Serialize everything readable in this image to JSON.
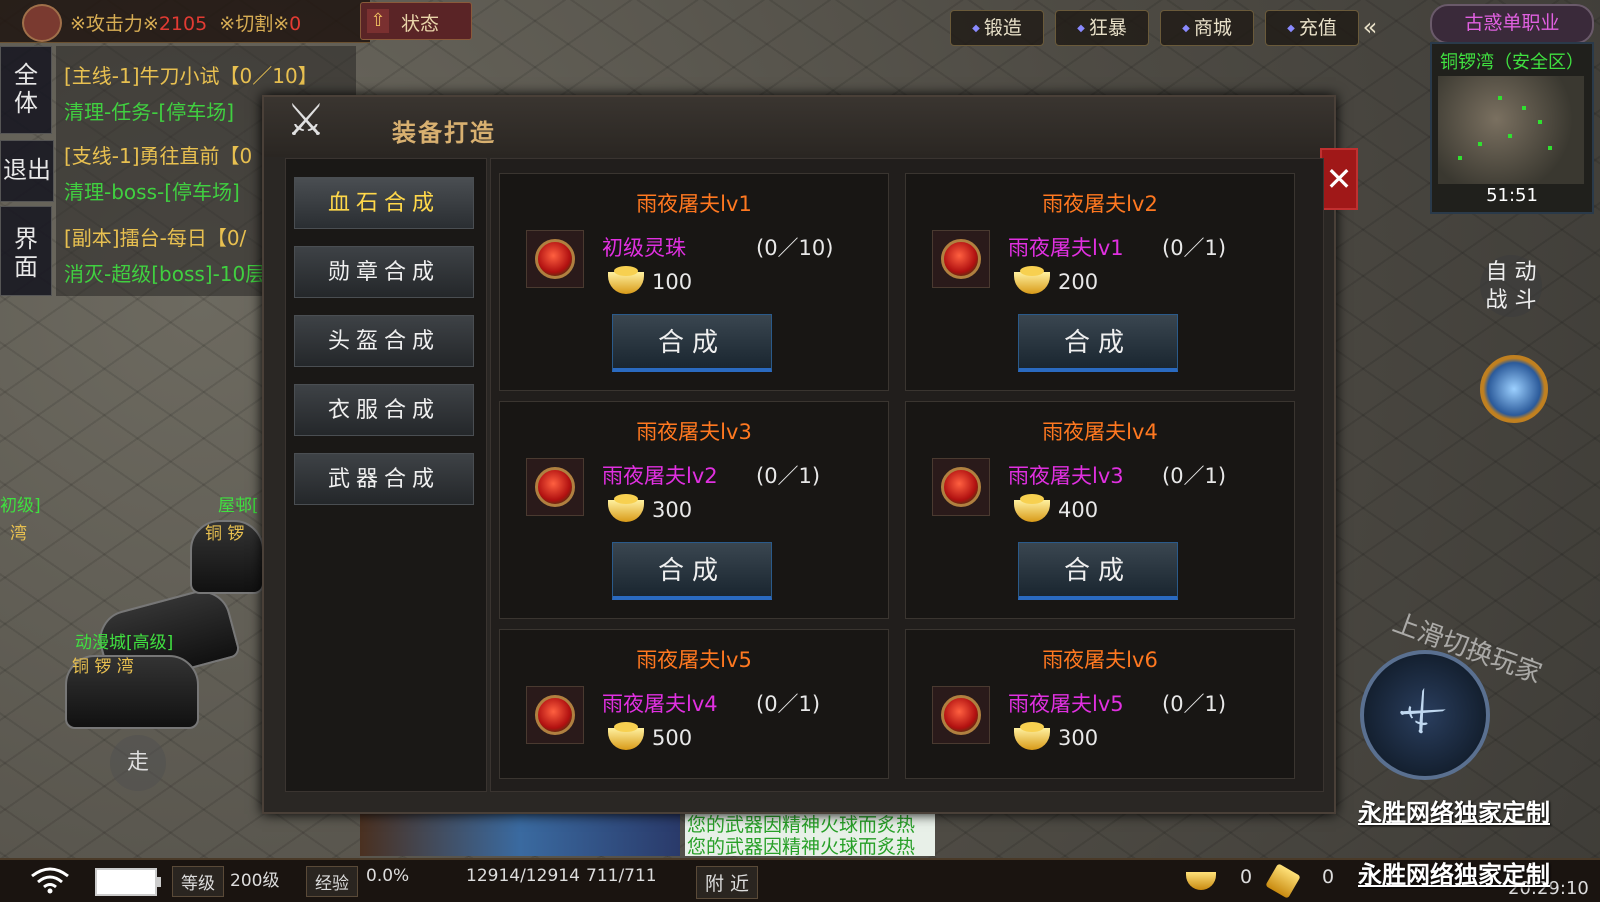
{
  "hud": {
    "attack_label": "※攻击力※",
    "attack_value": "2105",
    "cut_label": "※切割※",
    "cut_value": "0",
    "state_button": "状态",
    "side_buttons": [
      "全\n体",
      "退出",
      "界\n面"
    ],
    "top_tabs": [
      "锻造",
      "狂暴",
      "商城",
      "充值"
    ],
    "collapse": "«",
    "job": "古惑单职业",
    "minimap_zone": "铜锣湾（安全区）",
    "minimap_time": "51:51",
    "auto_fight": "自 动\n战 斗",
    "walk": "走",
    "swipe_hint": "上滑切换玩家",
    "brand_1": "永胜网络独家定制",
    "brand_2": "永胜网络独家定制",
    "clock": "20:29:10"
  },
  "quests": [
    {
      "title": "[主线-1]牛刀小试【0／10】",
      "detail": "清理-任务-[停车场]"
    },
    {
      "title": "[支线-1]勇往直前【0",
      "detail": "清理-boss-[停车场]"
    },
    {
      "title": "[副本]擂台-每日【0/",
      "detail": "消灭-超级[boss]-10层"
    }
  ],
  "npcs": [
    {
      "name": "动漫城[高级]",
      "sub": "铜 锣 湾"
    },
    {
      "name": "屋邨[",
      "sub": "铜 锣"
    },
    {
      "name": "初级]",
      "sub": "湾"
    }
  ],
  "chat": {
    "messages": [
      "您的武器因精神火球而炙热",
      "您的武器因精神火球而炙热"
    ]
  },
  "status_bar": {
    "level_label": "等级",
    "level_value": "200级",
    "exp_label": "经验",
    "exp_value": "0.0%",
    "hp": "12914/12914",
    "mp": "711/711",
    "nearby": "附 近",
    "gold": "0",
    "ticket": "0"
  },
  "dialog": {
    "title": "装备打造",
    "close": "✕",
    "nav": [
      {
        "label": "血石合成",
        "active": true
      },
      {
        "label": "勋章合成",
        "active": false
      },
      {
        "label": "头盔合成",
        "active": false
      },
      {
        "label": "衣服合成",
        "active": false
      },
      {
        "label": "武器合成",
        "active": false
      }
    ],
    "synth_label": "合成",
    "recipes": [
      {
        "title": "雨夜屠夫lv1",
        "material": "初级灵珠",
        "count": "(0／10)",
        "cost": "100"
      },
      {
        "title": "雨夜屠夫lv2",
        "material": "雨夜屠夫lv1",
        "count": "(0／1)",
        "cost": "200"
      },
      {
        "title": "雨夜屠夫lv3",
        "material": "雨夜屠夫lv2",
        "count": "(0／1)",
        "cost": "300"
      },
      {
        "title": "雨夜屠夫lv4",
        "material": "雨夜屠夫lv3",
        "count": "(0／1)",
        "cost": "400"
      },
      {
        "title": "雨夜屠夫lv5",
        "material": "雨夜屠夫lv4",
        "count": "(0／1)",
        "cost": "500"
      },
      {
        "title": "雨夜屠夫lv6",
        "material": "雨夜屠夫lv5",
        "count": "(0／1)",
        "cost": "300"
      }
    ]
  }
}
